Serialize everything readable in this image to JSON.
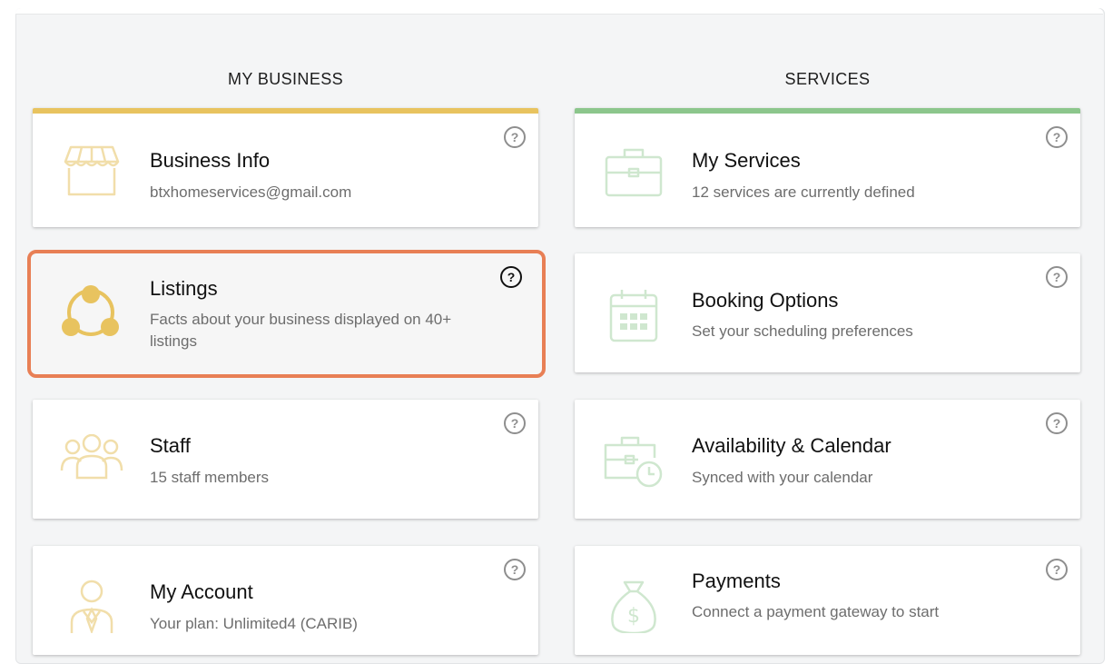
{
  "columns": {
    "left_heading": "MY BUSINESS",
    "right_heading": "SERVICES"
  },
  "colors": {
    "yellow_accent": "#e8c35f",
    "green_accent": "#8cc68c",
    "highlight": "#e87f55"
  },
  "help_glyph": "?",
  "left_cards": [
    {
      "title": "Business Info",
      "subtitle": "btxhomeservices@gmail.com",
      "icon": "storefront-icon"
    },
    {
      "title": "Listings",
      "subtitle_line1": "Facts about your business displayed on 40+",
      "subtitle_line2": "listings",
      "icon": "network-icon"
    },
    {
      "title": "Staff",
      "subtitle": "15 staff members",
      "icon": "people-icon"
    },
    {
      "title": "My Account",
      "subtitle": "Your plan: Unlimited4 (CARIB)",
      "icon": "user-tie-icon"
    }
  ],
  "right_cards": [
    {
      "title": "My Services",
      "subtitle": "12 services are currently defined",
      "icon": "briefcase-icon"
    },
    {
      "title": "Booking Options",
      "subtitle": "Set your scheduling preferences",
      "icon": "calendar-icon"
    },
    {
      "title": "Availability & Calendar",
      "subtitle": "Synced with your calendar",
      "icon": "briefcase-clock-icon"
    },
    {
      "title": "Payments",
      "subtitle": "Connect a payment gateway to start",
      "icon": "money-bag-icon"
    }
  ]
}
